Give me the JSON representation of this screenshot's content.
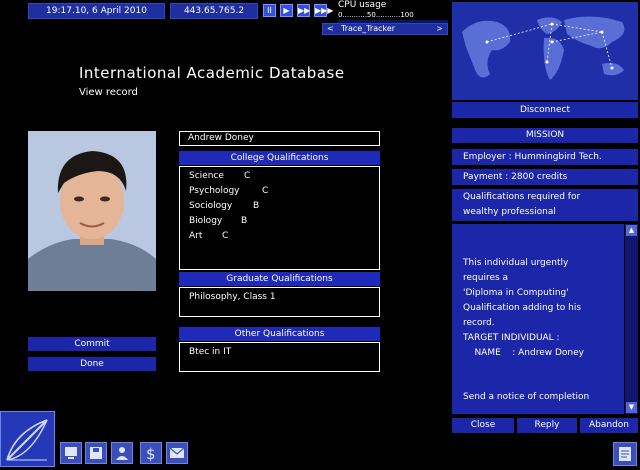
{
  "topbar": {
    "datetime": "19:17.10, 6 April 2010",
    "ip": "443.65.765.2",
    "cpu_label": "CPU usage",
    "cpu_scale": "0...........50...........100",
    "cpu_usage": 0,
    "tracker_left": "<",
    "tracker_label": "Trace_Tracker",
    "tracker_right": ">",
    "speed_buttons": [
      "II",
      "▶",
      "▶▶",
      "▶▶▶"
    ]
  },
  "main": {
    "title": "International Academic Database",
    "subtitle": "View record",
    "name_value": "Andrew Doney",
    "college_header": "College Qualifications",
    "college": [
      {
        "subject": "Science",
        "grade": "C"
      },
      {
        "subject": "Psychology",
        "grade": "C"
      },
      {
        "subject": "Sociology",
        "grade": "B"
      },
      {
        "subject": "Biology",
        "grade": "B"
      },
      {
        "subject": "Art",
        "grade": "C"
      }
    ],
    "graduate_header": "Graduate Qualifications",
    "graduate_value": "Philosophy, Class 1",
    "other_header": "Other Qualifications",
    "other_value": "Btec in IT",
    "commit_label": "Commit",
    "done_label": "Done"
  },
  "sidebar": {
    "disconnect_label": "Disconnect",
    "mission_header": "MISSION",
    "employer": "Employer : Hummingbird Tech.",
    "payment": "Payment : 2800 credits",
    "requirement_line1": "Qualifications required for",
    "requirement_line2": "wealthy professional",
    "message_lines": [
      "This individual urgently",
      "requires a",
      "'Diploma in Computing'",
      "Qualification adding to his",
      "record.",
      "TARGET INDIVIDUAL :",
      "    NAME    : Andrew Doney"
    ],
    "completion_line": "Send a notice of completion",
    "close_label": "Close",
    "reply_label": "Reply",
    "abandon_label": "Abandon"
  },
  "colors": {
    "panel_blue": "#1b27a8",
    "bar_blue": "#1f2f9f",
    "background": "#000000"
  }
}
